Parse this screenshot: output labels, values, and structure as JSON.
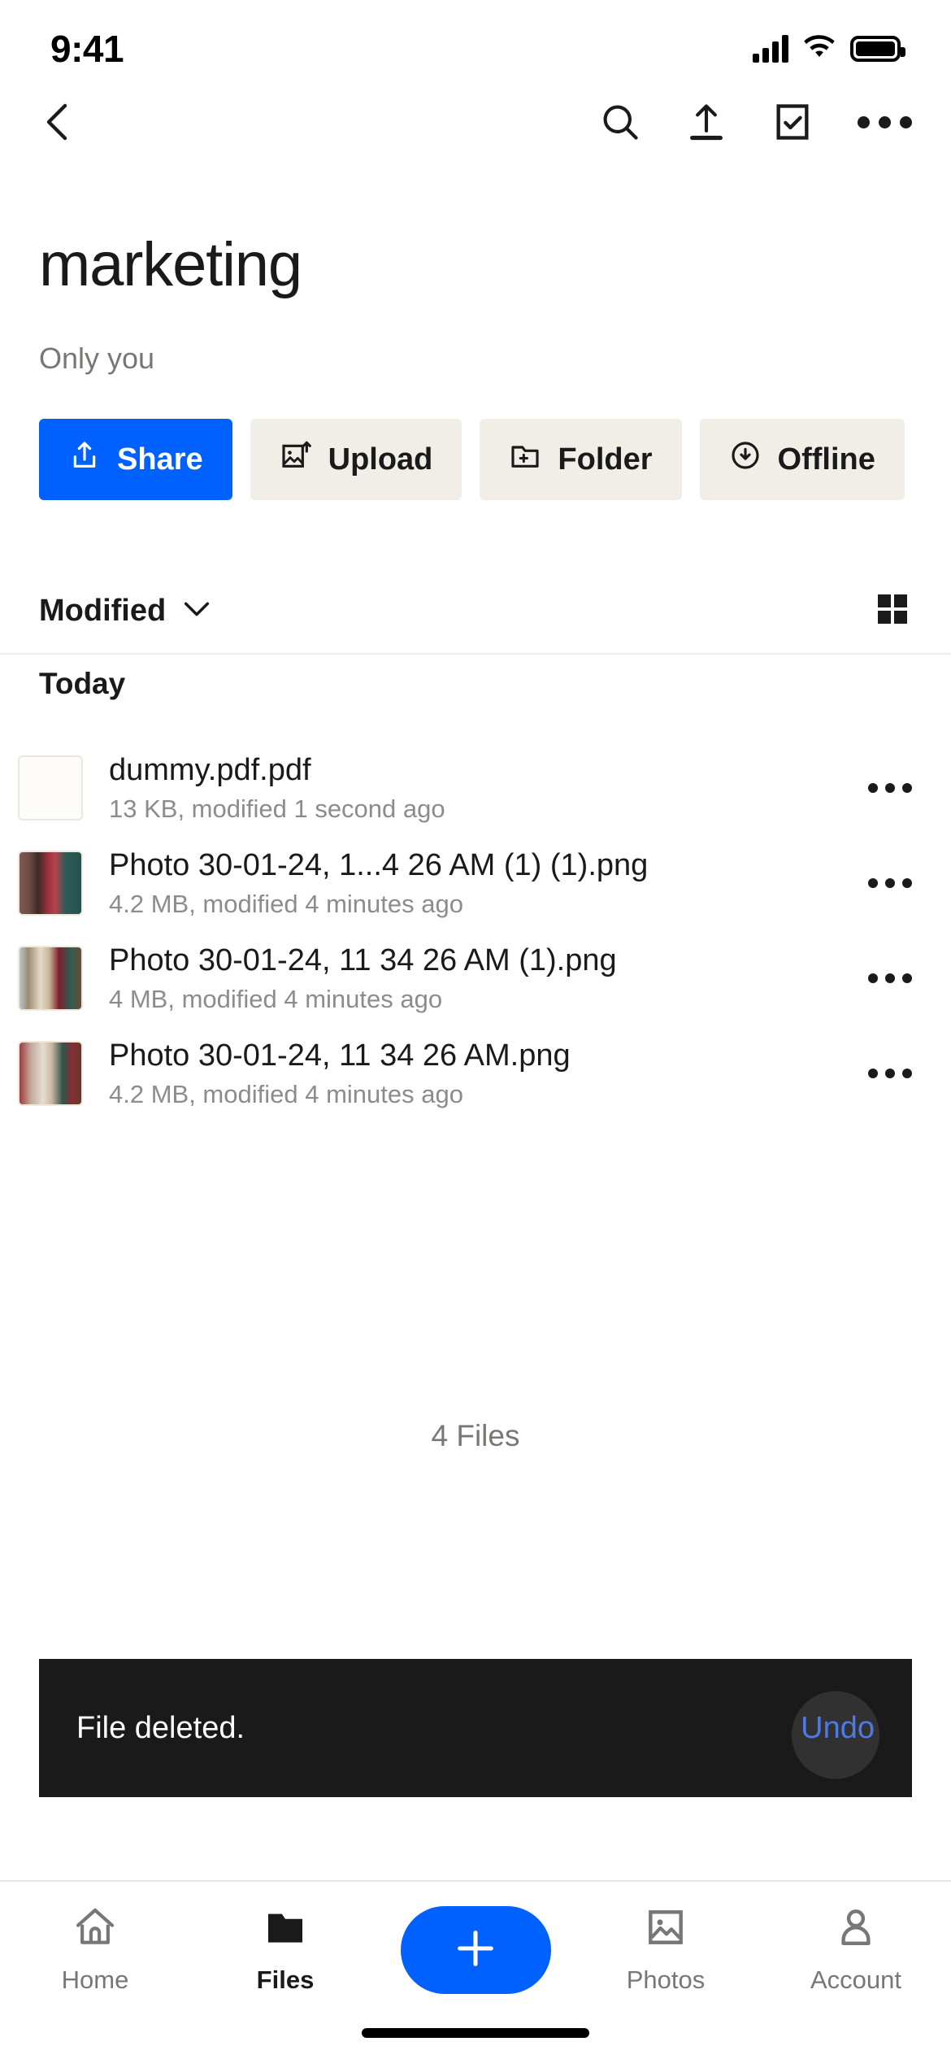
{
  "status_bar": {
    "time": "9:41",
    "cellular_icon": "signal-bars-icon",
    "wifi_icon": "wifi-icon",
    "battery_icon": "battery-full-icon"
  },
  "nav": {
    "back_icon": "back-chevron-icon",
    "search_icon": "search-icon",
    "upload_icon": "upload-icon",
    "select_icon": "checkbox-select-icon",
    "more_icon": "more-horizontal-icon"
  },
  "header": {
    "title": "marketing",
    "subtitle": "Only you"
  },
  "actions": [
    {
      "label": "Share",
      "icon": "share-icon",
      "primary": true
    },
    {
      "label": "Upload",
      "icon": "image-upload-icon",
      "primary": false
    },
    {
      "label": "Folder",
      "icon": "folder-plus-icon",
      "primary": false
    },
    {
      "label": "Offline",
      "icon": "cloud-download-icon",
      "primary": false
    }
  ],
  "sort": {
    "label": "Modified",
    "chevron_icon": "chevron-down-icon",
    "view_toggle_icon": "grid-view-icon"
  },
  "list": {
    "section_header": "Today",
    "files": [
      {
        "name": "dummy.pdf.pdf",
        "meta": "13 KB, modified 1 second ago",
        "thumb_type": "placeholder",
        "menu_icon": "more-horizontal-icon"
      },
      {
        "name": "Photo 30-01-24, 1...4 26 AM (1) (1).png",
        "meta": "4.2 MB, modified 4 minutes ago",
        "thumb_type": "photo-a",
        "menu_icon": "more-horizontal-icon"
      },
      {
        "name": "Photo 30-01-24, 11 34 26 AM (1).png",
        "meta": "4 MB, modified 4 minutes ago",
        "thumb_type": "photo-b",
        "menu_icon": "more-horizontal-icon"
      },
      {
        "name": "Photo 30-01-24, 11 34 26 AM.png",
        "meta": "4.2 MB, modified 4 minutes ago",
        "thumb_type": "photo-c",
        "menu_icon": "more-horizontal-icon"
      }
    ],
    "file_count": "4 Files"
  },
  "toast": {
    "message": "File deleted.",
    "action_label": "Undo"
  },
  "tabbar": {
    "items": [
      {
        "label": "Home",
        "icon": "home-icon",
        "active": false
      },
      {
        "label": "Files",
        "icon": "folder-icon",
        "active": true
      },
      {
        "label": "Photos",
        "icon": "photos-icon",
        "active": false
      },
      {
        "label": "Account",
        "icon": "person-icon",
        "active": false
      }
    ],
    "fab_icon": "plus-icon"
  },
  "colors": {
    "accent": "#0061FE",
    "chip_bg": "#F1EEE8",
    "toast_bg": "#1A1A1A",
    "toast_action": "#3B6AE0",
    "muted_text": "#8C8C8C"
  }
}
